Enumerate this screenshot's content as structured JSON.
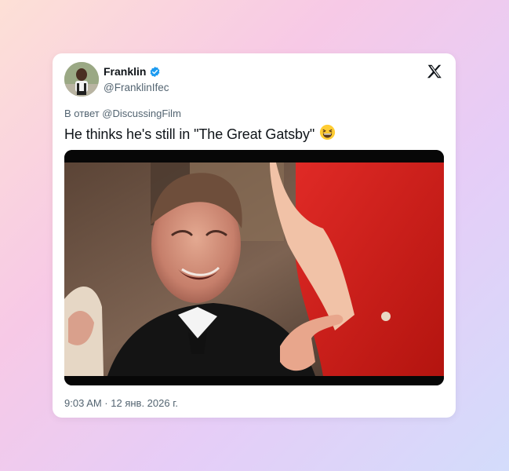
{
  "tweet": {
    "author_name": "Franklin",
    "author_handle": "@FranklinIfec",
    "reply_to": "В ответ @DiscussingFilm",
    "text": "He thinks he's still in \"The Great Gatsby\"",
    "emoji": "grinning-squinting-face",
    "timestamp": "9:03 AM · 12 янв. 2026 г."
  },
  "colors": {
    "verified": "#1d9bf0",
    "secondary_text": "#536471",
    "primary_text": "#0f1419",
    "dress_red": "#d0181c"
  },
  "icons": [
    "verified-badge-icon",
    "x-logo-icon"
  ]
}
